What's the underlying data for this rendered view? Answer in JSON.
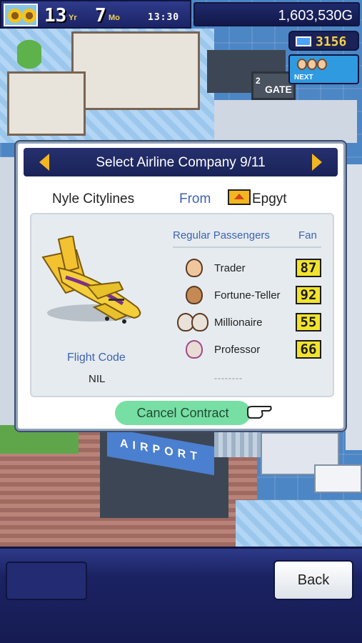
{
  "hud": {
    "year": "13",
    "year_unit": "Yr",
    "month": "7",
    "month_unit": "Mo",
    "time": "13:30",
    "money": "1,603,530G",
    "points": "3156",
    "next_label": "NEXT"
  },
  "scene": {
    "gate_number": "2",
    "gate_sign": "GATE",
    "airport_sign": "AIRPORT"
  },
  "dialog": {
    "title": "Select Airline Company 9/11",
    "airline_name": "Nyle Citylines",
    "from_label": "From",
    "country": "Epgyt",
    "flight_code_label": "Flight Code",
    "flight_code_value": "NIL",
    "passengers_header": "Regular Passengers",
    "fan_header": "Fan",
    "passengers": [
      {
        "name": "Trader",
        "fan": "87"
      },
      {
        "name": "Fortune-Teller",
        "fan": "92"
      },
      {
        "name": "Millionaire",
        "fan": "55"
      },
      {
        "name": "Professor",
        "fan": "66"
      }
    ],
    "empty_slot": "--------",
    "cancel_label": "Cancel Contract"
  },
  "footer": {
    "back_label": "Back"
  },
  "colors": {
    "accent_yellow": "#f3b61f",
    "header_navy": "#1a2358",
    "link_blue": "#3d63b3",
    "cancel_green": "#78dfa4",
    "fan_yellow": "#f2e32c"
  }
}
